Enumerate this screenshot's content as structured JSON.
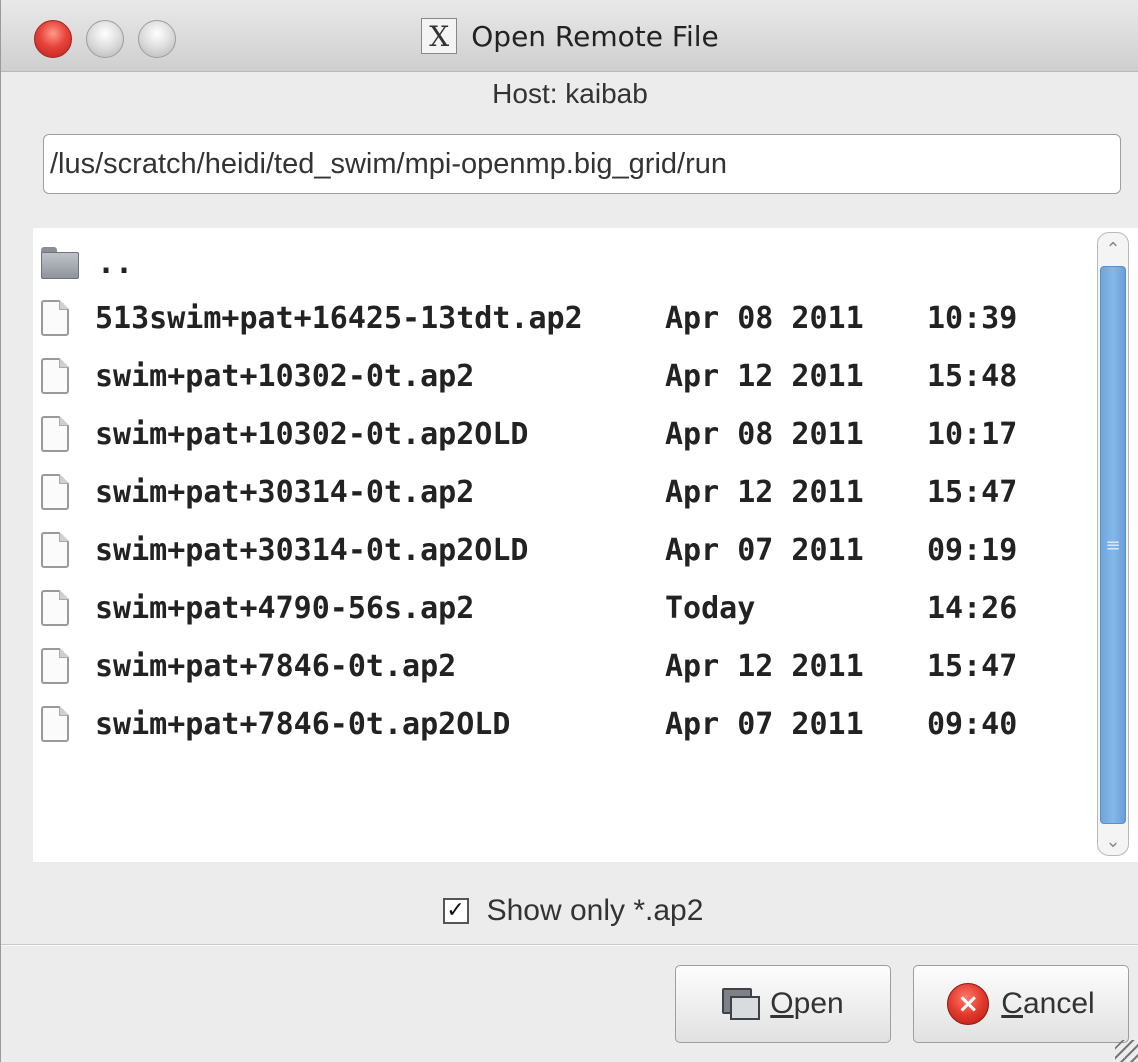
{
  "window": {
    "title": "Open Remote File",
    "x_icon_glyph": "X"
  },
  "host_label": "Host: kaibab",
  "path": "/lus/scratch/heidi/ted_swim/mpi-openmp.big_grid/run",
  "files": [
    {
      "icon": "folder-icon",
      "name": "..",
      "date": "",
      "time": ""
    },
    {
      "icon": "file-icon",
      "name": "513swim+pat+16425-13tdt.ap2",
      "date": "Apr 08 2011",
      "time": "10:39"
    },
    {
      "icon": "file-icon",
      "name": "swim+pat+10302-0t.ap2",
      "date": "Apr 12 2011",
      "time": "15:48"
    },
    {
      "icon": "file-icon",
      "name": "swim+pat+10302-0t.ap2OLD",
      "date": "Apr 08 2011",
      "time": "10:17"
    },
    {
      "icon": "file-icon",
      "name": "swim+pat+30314-0t.ap2",
      "date": "Apr 12 2011",
      "time": "15:47"
    },
    {
      "icon": "file-icon",
      "name": "swim+pat+30314-0t.ap2OLD",
      "date": "Apr 07 2011",
      "time": "09:19"
    },
    {
      "icon": "file-icon",
      "name": "swim+pat+4790-56s.ap2",
      "date": "Today",
      "time": "14:26"
    },
    {
      "icon": "file-icon",
      "name": "swim+pat+7846-0t.ap2",
      "date": "Apr 12 2011",
      "time": "15:47"
    },
    {
      "icon": "file-icon",
      "name": "swim+pat+7846-0t.ap2OLD",
      "date": "Apr 07 2011",
      "time": "09:40"
    }
  ],
  "filter": {
    "checked": true,
    "check_glyph": "✓",
    "label": "Show only *.ap2"
  },
  "buttons": {
    "open": {
      "accel": "O",
      "rest": "pen"
    },
    "cancel": {
      "accel": "C",
      "rest": "ancel",
      "icon_glyph": "×"
    }
  },
  "scrollbar": {
    "up_glyph": "⌃",
    "down_glyph": "⌄",
    "grip_glyph": "≡"
  },
  "colors": {
    "close_button": "#e8433a",
    "scroll_thumb": "#86b7e8",
    "cancel_icon": "#e23a2c"
  }
}
